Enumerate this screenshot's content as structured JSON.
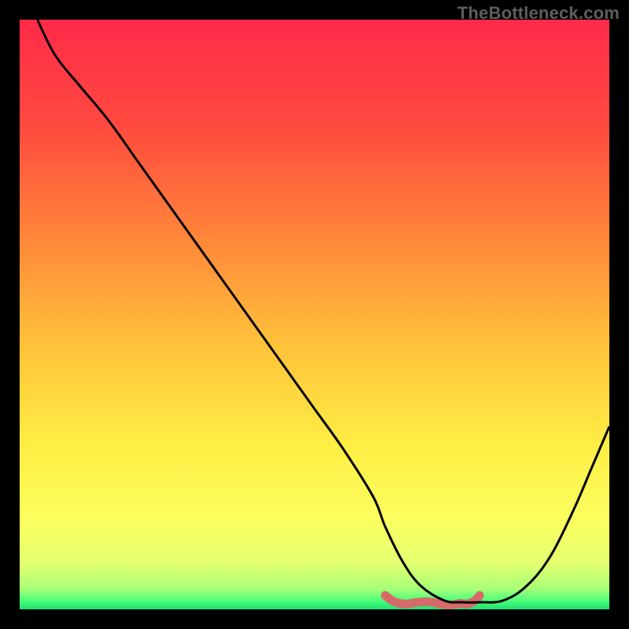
{
  "watermark": "TheBottleneck.com",
  "chart_data": {
    "type": "line",
    "title": "",
    "xlabel": "",
    "ylabel": "",
    "xlim": [
      0,
      100
    ],
    "ylim": [
      0,
      100
    ],
    "x": [
      3,
      6,
      10,
      15,
      20,
      25,
      30,
      35,
      40,
      45,
      50,
      55,
      60,
      62,
      65,
      68,
      72,
      75,
      78,
      82,
      86,
      90,
      94,
      97,
      100
    ],
    "values": [
      100,
      94,
      89,
      83,
      76,
      69,
      62,
      55,
      48,
      41,
      34,
      27,
      19,
      14,
      8,
      4,
      1.5,
      1.2,
      1.2,
      1.5,
      4,
      9,
      17,
      24,
      31
    ],
    "gradient_stops": [
      {
        "offset": 0.0,
        "color": "#ff2b49"
      },
      {
        "offset": 0.18,
        "color": "#ff4a3f"
      },
      {
        "offset": 0.38,
        "color": "#ff8a3a"
      },
      {
        "offset": 0.55,
        "color": "#ffc23a"
      },
      {
        "offset": 0.72,
        "color": "#ffee45"
      },
      {
        "offset": 0.85,
        "color": "#fbff60"
      },
      {
        "offset": 0.92,
        "color": "#e6ff70"
      },
      {
        "offset": 0.965,
        "color": "#a8ff78"
      },
      {
        "offset": 0.985,
        "color": "#4eff7a"
      },
      {
        "offset": 1.0,
        "color": "#20e070"
      }
    ],
    "marker_band": {
      "y": 1.3,
      "x_start": 62,
      "x_end": 78,
      "stroke": "#d66a6a",
      "width": 11
    }
  }
}
